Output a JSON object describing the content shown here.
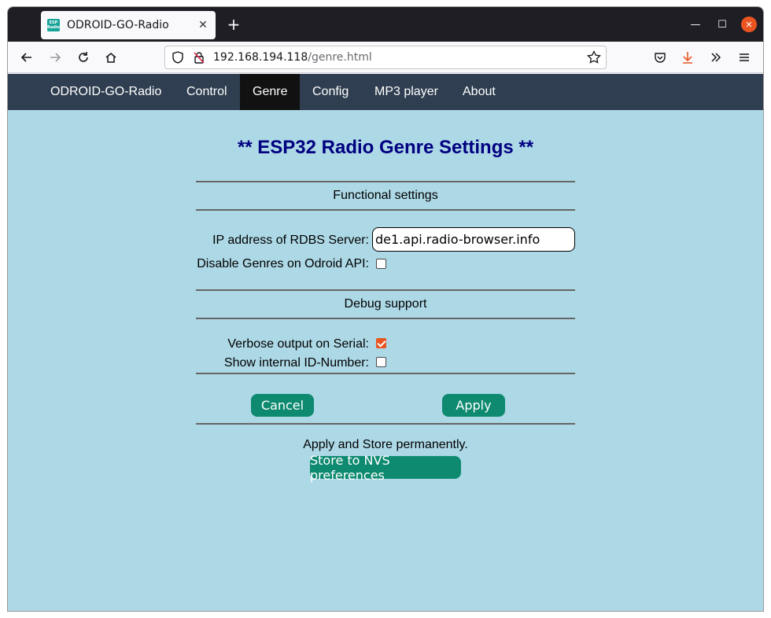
{
  "browser": {
    "tab_title": "ODROID-GO-Radio",
    "favicon_text": [
      "ESP",
      "Radio"
    ],
    "url_host": "192.168.194.118",
    "url_path": "/genre.html"
  },
  "site_nav": {
    "items": [
      {
        "label": "ODROID-GO-Radio",
        "active": false
      },
      {
        "label": "Control",
        "active": false
      },
      {
        "label": "Genre",
        "active": true
      },
      {
        "label": "Config",
        "active": false
      },
      {
        "label": "MP3 player",
        "active": false
      },
      {
        "label": "About",
        "active": false
      }
    ]
  },
  "page": {
    "heading": "** ESP32 Radio Genre Settings **",
    "functional": {
      "title": "Functional settings",
      "server_label": "IP address of RDBS Server:",
      "server_value": "de1.api.radio-browser.info",
      "disable_label": "Disable Genres on Odroid API:",
      "disable_checked": false
    },
    "debug": {
      "title": "Debug support",
      "verbose_label": "Verbose output on Serial:",
      "verbose_checked": true,
      "show_id_label": "Show internal ID-Number:",
      "show_id_checked": false
    },
    "buttons": {
      "cancel": "Cancel",
      "apply": "Apply"
    },
    "store": {
      "text": "Apply and Store permanently.",
      "button": "Store to NVS preferences"
    }
  },
  "colors": {
    "page_bg": "#add8e6",
    "nav_bg": "#2f3e50",
    "heading": "#000080",
    "button": "#0e8a70",
    "accent": "#e95420"
  }
}
